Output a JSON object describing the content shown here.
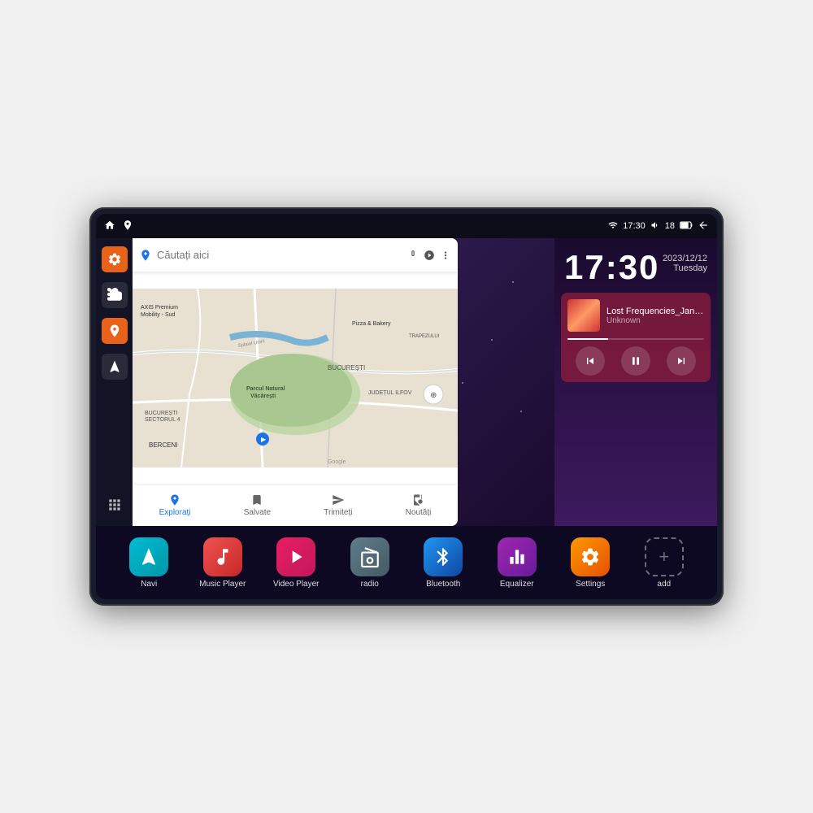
{
  "device": {
    "status_bar": {
      "left_icons": [
        "home",
        "location"
      ],
      "time": "17:30",
      "right_icons": [
        "wifi",
        "volume",
        "18",
        "battery",
        "back"
      ]
    },
    "clock": {
      "time": "17:30",
      "date": "2023/12/12",
      "weekday": "Tuesday"
    },
    "music": {
      "title": "Lost Frequencies_Janie...",
      "artist": "Unknown",
      "progress": 30
    },
    "map": {
      "search_placeholder": "Căutați aici",
      "locations": [
        "AXIS Premium Mobility - Sud",
        "Pizza & Bakery",
        "Parcul Natural Văcărești",
        "BUCUREȘTI",
        "BUCUREȘTI SECTORUL 4",
        "JUDEȚUL ILFOV",
        "BERCENI",
        "TRAPEZULUI"
      ],
      "tabs": [
        "Explorați",
        "Salvate",
        "Trimiteți",
        "Noutăți"
      ]
    },
    "sidebar": {
      "items": [
        "settings",
        "storage",
        "location",
        "navigation",
        "apps-grid"
      ]
    },
    "apps": [
      {
        "label": "Navi",
        "color": "teal",
        "icon": "🧭"
      },
      {
        "label": "Music Player",
        "color": "red",
        "icon": "🎵"
      },
      {
        "label": "Video Player",
        "color": "pink",
        "icon": "▶"
      },
      {
        "label": "radio",
        "color": "gray",
        "icon": "📻"
      },
      {
        "label": "Bluetooth",
        "color": "blue",
        "icon": "🔵"
      },
      {
        "label": "Equalizer",
        "color": "purple",
        "icon": "🎛"
      },
      {
        "label": "Settings",
        "color": "orange",
        "icon": "⚙"
      },
      {
        "label": "add",
        "color": "grid",
        "icon": "+"
      }
    ]
  }
}
